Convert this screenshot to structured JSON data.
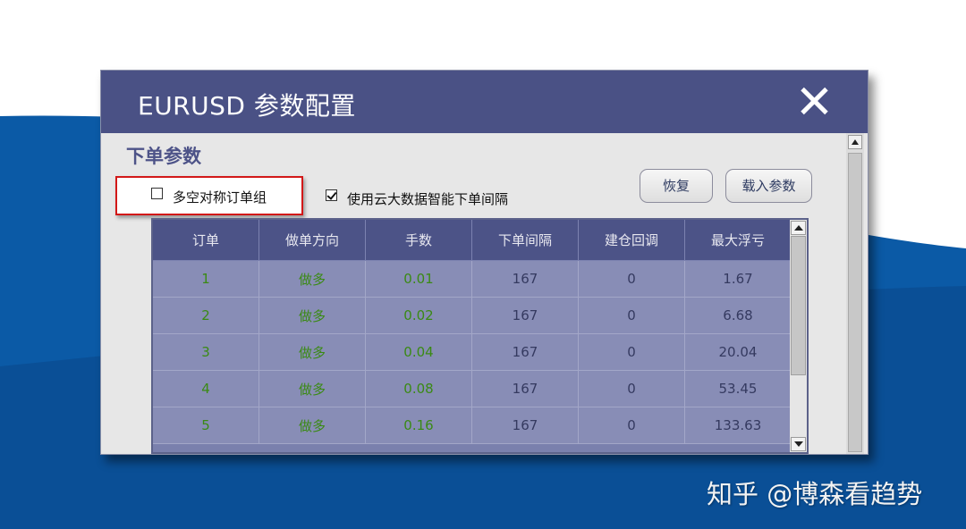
{
  "colors": {
    "titlebar": "#4a5185",
    "grid_header": "#4c5387",
    "grid_cell": "#888db6",
    "green_text": "#3a8a14",
    "highlight": "#d21818",
    "bg_blue": "#0b5aa6"
  },
  "dialog": {
    "title": "EURUSD 参数配置",
    "close_icon": "close-icon"
  },
  "section": {
    "title": "下单参数"
  },
  "options": {
    "symmetric_label": "多空对称订单组",
    "symmetric_checked": false,
    "smart_interval_label": "使用云大数据智能下单间隔",
    "smart_interval_checked": true
  },
  "buttons": {
    "restore": "恢复",
    "load": "载入参数"
  },
  "table": {
    "headers": [
      "订单",
      "做单方向",
      "手数",
      "下单间隔",
      "建仓回调",
      "最大浮亏"
    ],
    "rows": [
      [
        "1",
        "做多",
        "0.01",
        "167",
        "0",
        "1.67"
      ],
      [
        "2",
        "做多",
        "0.02",
        "167",
        "0",
        "6.68"
      ],
      [
        "3",
        "做多",
        "0.04",
        "167",
        "0",
        "20.04"
      ],
      [
        "4",
        "做多",
        "0.08",
        "167",
        "0",
        "53.45"
      ],
      [
        "5",
        "做多",
        "0.16",
        "167",
        "0",
        "133.63"
      ]
    ]
  },
  "watermark": "知乎 @博森看趋势"
}
